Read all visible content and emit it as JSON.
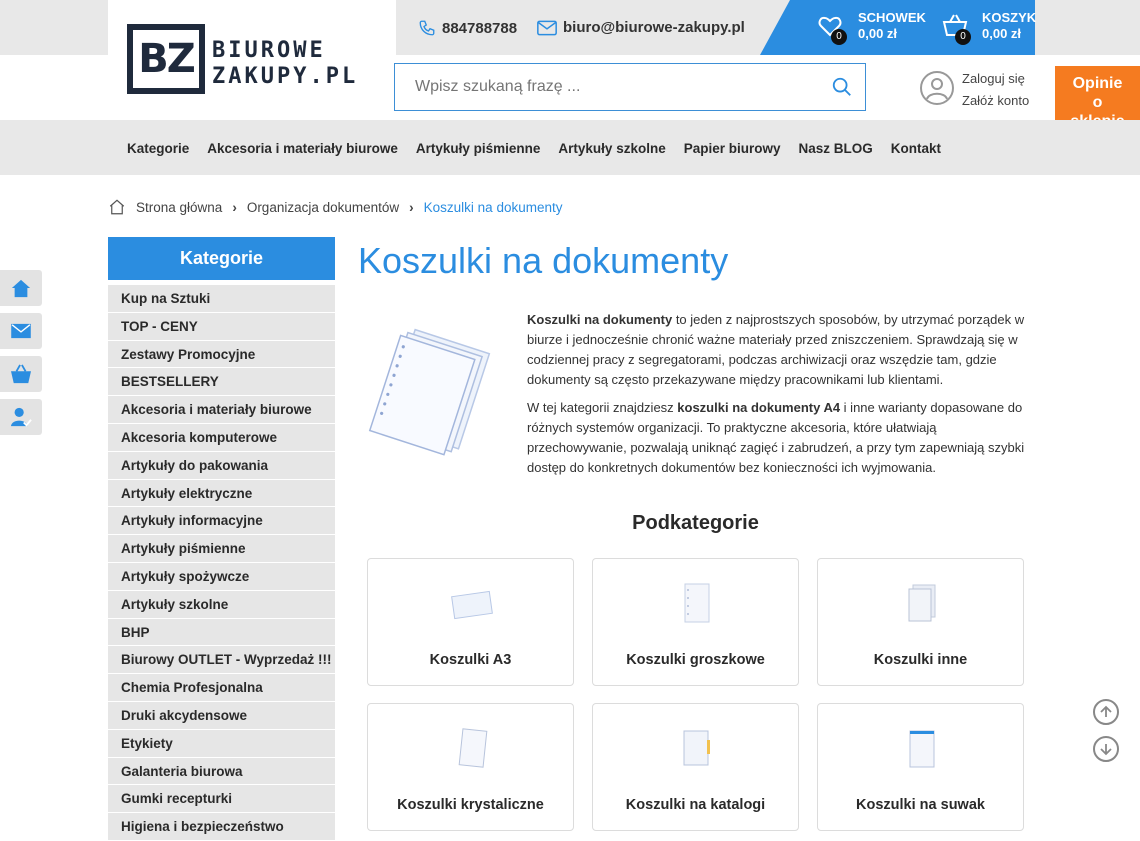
{
  "header": {
    "logo_letters": "BZ",
    "logo_line1": "BIUROWE",
    "logo_line2": "ZAKUPY.PL",
    "phone": "884788788",
    "email": "biuro@biurowe-zakupy.pl",
    "wishlist": {
      "label": "SCHOWEK",
      "amount": "0,00 zł",
      "count": "0"
    },
    "cart": {
      "label": "KOSZYK",
      "amount": "0,00 zł",
      "count": "0"
    },
    "search_placeholder": "Wpisz szukaną frazę ...",
    "login": "Zaloguj się",
    "register": "Załóż konto",
    "opinie": [
      "Opinie",
      "o",
      "sklepie"
    ]
  },
  "nav": [
    "Kategorie",
    "Akcesoria i materiały biurowe",
    "Artykuły piśmienne",
    "Artykuły szkolne",
    "Papier biurowy",
    "Nasz BLOG",
    "Kontakt"
  ],
  "breadcrumb": [
    "Strona główna",
    "Organizacja dokumentów",
    "Koszulki na dokumenty"
  ],
  "sidebar": {
    "title": "Kategorie",
    "items": [
      "Kup na Sztuki",
      "TOP - CENY",
      "Zestawy Promocyjne",
      "BESTSELLERY",
      "Akcesoria i materiały biurowe",
      "Akcesoria komputerowe",
      "Artykuły do pakowania",
      "Artykuły elektryczne",
      "Artykuły informacyjne",
      "Artykuły piśmienne",
      "Artykuły spożywcze",
      "Artykuły szkolne",
      "BHP",
      "Biurowy OUTLET - Wyprzedaż !!!",
      "Chemia Profesjonalna",
      "Druki akcydensowe",
      "Etykiety",
      "Galanteria biurowa",
      "Gumki recepturki",
      "Higiena i bezpieczeństwo"
    ]
  },
  "side_icons": [
    "home-icon",
    "mail-icon",
    "basket-icon",
    "user-check-icon"
  ],
  "main": {
    "title": "Koszulki na dokumenty",
    "p1_bold": "Koszulki na dokumenty",
    "p1_rest": " to jeden z najprostszych sposobów, by utrzymać porządek w biurze i jednocześnie chronić ważne materiały przed zniszczeniem. Sprawdzają się w codziennej pracy z segregatorami, podczas archiwizacji oraz wszędzie tam, gdzie dokumenty są często przekazywane między pracownikami lub klientami.",
    "p2_start": "W tej kategorii znajdziesz ",
    "p2_bold": "koszulki na dokumenty A4",
    "p2_rest": " i inne warianty dopasowane do różnych systemów organizacji. To praktyczne akcesoria, które ułatwiają przechowywanie, pozwalają uniknąć zagięć i zabrudzeń, a przy tym zapewniają szybki dostęp do konkretnych dokumentów bez konieczności ich wyjmowania.",
    "subcategories_title": "Podkategorie",
    "subcategories": [
      "Koszulki A3",
      "Koszulki groszkowe",
      "Koszulki inne",
      "Koszulki krystaliczne",
      "Koszulki na katalogi",
      "Koszulki na suwak"
    ]
  },
  "colors": {
    "accent": "#2b8de0",
    "orange": "#f57b20",
    "navy": "#1f2a3c"
  }
}
